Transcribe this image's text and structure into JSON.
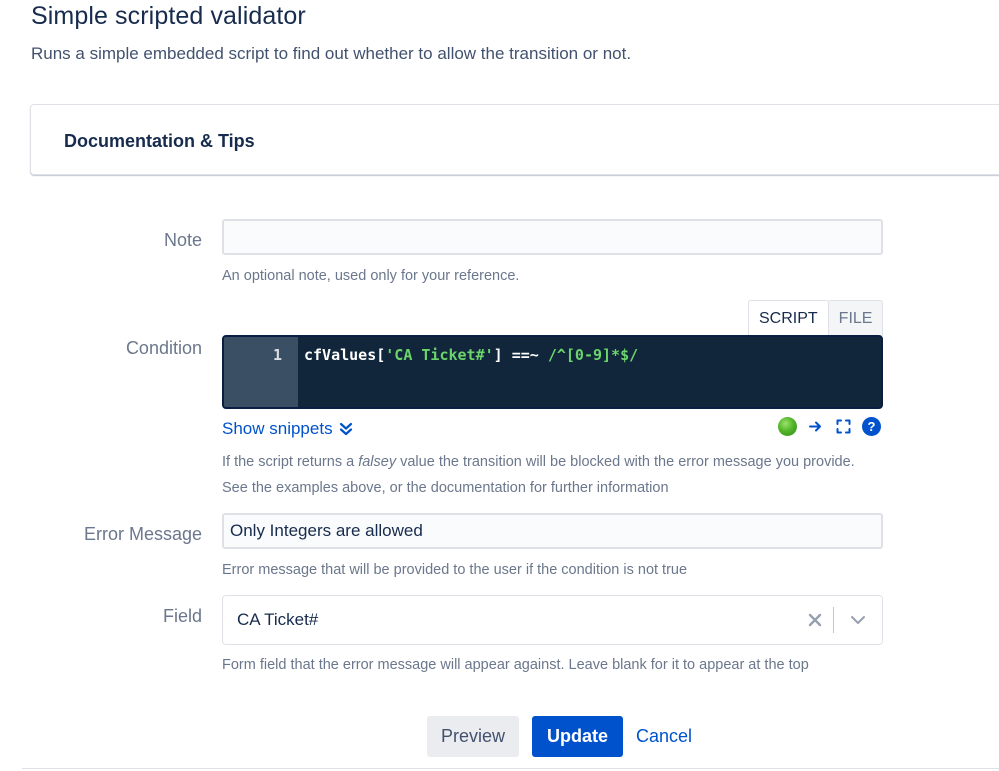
{
  "page": {
    "title": "Simple scripted validator",
    "description": "Runs a simple embedded script to find out whether to allow the transition or not."
  },
  "doc_panel": {
    "title": "Documentation & Tips"
  },
  "note": {
    "label": "Note",
    "value": "",
    "placeholder": "",
    "help": "An optional note, used only for your reference."
  },
  "condition": {
    "label": "Condition",
    "tabs": [
      {
        "label": "SCRIPT",
        "active": true
      },
      {
        "label": "FILE",
        "active": false
      }
    ],
    "editor": {
      "line_number": "1",
      "code_tokens": {
        "t1": "cfValues[",
        "t2": "'CA Ticket#'",
        "t3": "] ==~ ",
        "t4": "/^[0-9]*$/"
      }
    },
    "show_snippets": "Show snippets",
    "help_prefix": "If the script returns a ",
    "help_emph": "falsey",
    "help_suffix": " value the transition will be blocked with the error message you provide.",
    "help_line2": "See the examples above, or the documentation for further information",
    "status": "valid"
  },
  "error_message": {
    "label": "Error Message",
    "value": "Only Integers are allowed",
    "help": "Error message that will be provided to the user if the condition is not true"
  },
  "field": {
    "label": "Field",
    "value": "CA Ticket#",
    "help": "Form field that the error message will appear against. Leave blank for it to appear at the top"
  },
  "buttons": {
    "preview": "Preview",
    "update": "Update",
    "cancel": "Cancel"
  },
  "colors": {
    "primary": "#0052cc",
    "editor_bg": "#11263a",
    "gutter_bg": "#3a4f63",
    "code_string": "#6bd46b",
    "status_ok": "#53b52a"
  },
  "icons": {
    "snippets": "double-chevron-down-icon",
    "status": "status-ok-icon",
    "run": "arrow-right-icon",
    "fullscreen": "fullscreen-icon",
    "help": "help-icon",
    "clear": "close-icon",
    "dropdown": "chevron-down-icon"
  }
}
